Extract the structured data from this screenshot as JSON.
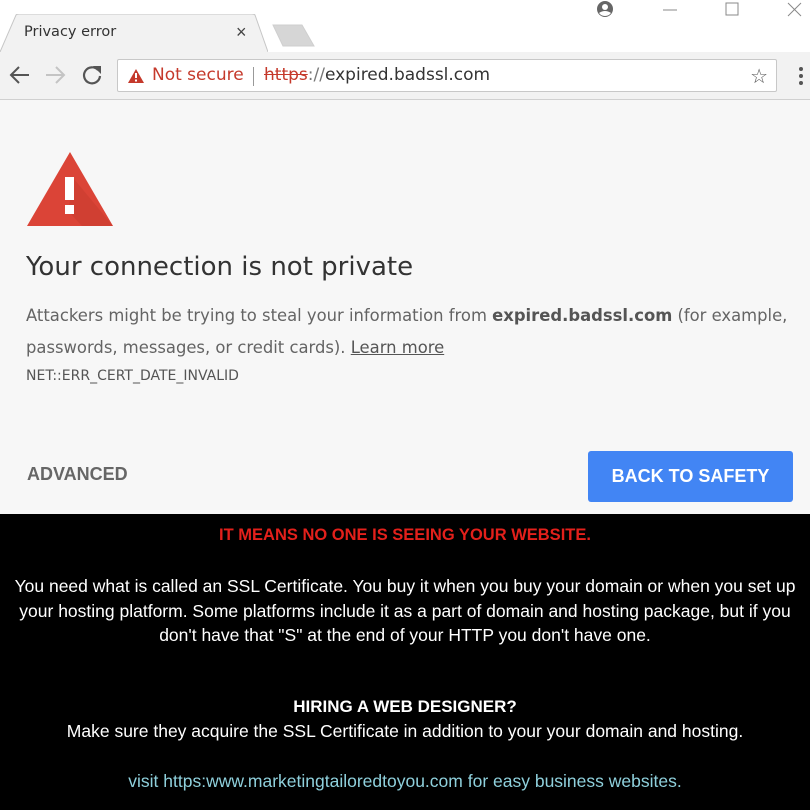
{
  "browser": {
    "tab": {
      "title": "Privacy error",
      "close_glyph": "×"
    },
    "address_bar": {
      "security_label": "Not secure",
      "url_scheme": "https",
      "url_separator": "://",
      "url_host": "expired.badssl.com",
      "star_glyph": "☆"
    },
    "icons": [
      "back-arrow-icon",
      "forward-arrow-icon",
      "reload-icon",
      "warning-icon",
      "star-icon",
      "menu-dots-icon",
      "profile-icon",
      "minimize-icon",
      "maximize-icon",
      "close-window-icon"
    ]
  },
  "interstitial": {
    "headline": "Your connection is not private",
    "desc_before": "Attackers might be trying to steal your information from ",
    "desc_host": "expired.badssl.com",
    "desc_after": " (for example, passwords, messages, or credit cards). ",
    "learn_more": "Learn more",
    "error_code": "NET::ERR_CERT_DATE_INVALID",
    "advanced_label": "ADVANCED",
    "back_label": "BACK TO SAFETY",
    "colors": {
      "warning": "#db4437",
      "button": "#4285f4"
    }
  },
  "banner": {
    "headline": "IT MEANS NO ONE IS SEEING YOUR WEBSITE.",
    "paragraph": "You need what is called an SSL Certificate. You buy it when you buy your domain or when you set up your hosting platform. Some platforms include it as a part of domain and hosting package, but if you don't have that \"S\" at the end of your HTTP you don't have one.",
    "question": "HIRING A WEB DESIGNER?",
    "advice": "Make sure they acquire the SSL Certificate in addition to your your domain and hosting.",
    "visit": "visit https:www.marketingtailoredtoyou.com for easy business websites.",
    "colors": {
      "headline": "#e3201b",
      "link": "#8fd0dc"
    }
  }
}
